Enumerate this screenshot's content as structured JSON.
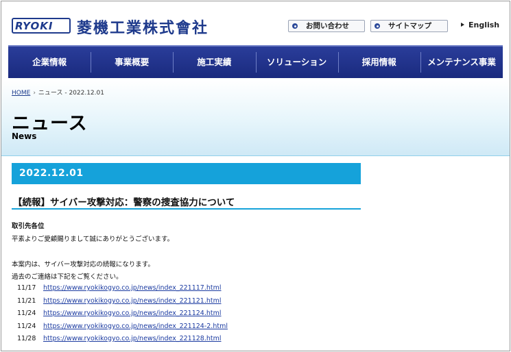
{
  "header": {
    "logo_text": "RYOKI",
    "company_name": "菱機工業株式會社",
    "util_links": [
      "お問い合わせ",
      "サイトマップ"
    ],
    "lang_link": "English"
  },
  "nav": {
    "items": [
      "企業情報",
      "事業概要",
      "施工実績",
      "ソリューション",
      "採用情報",
      "メンテナンス事業"
    ]
  },
  "breadcrumb": {
    "home": "HOME",
    "separator": "›",
    "current": "ニュース - 2022.12.01"
  },
  "page": {
    "title": "ニュース",
    "subtitle": "News"
  },
  "article": {
    "date": "2022.12.01",
    "title": "【続報】サイバー攻撃対応：警察の捜査協力について",
    "addressee": "取引先各位",
    "greeting": "平素よりご愛顧賜りまして誠にありがとうございます。",
    "intro": "本案内は、サイバー攻撃対応の続報になります。",
    "past_note": "過去のご連絡は下記をご覧ください。",
    "links": [
      {
        "date": "11/17",
        "url": "https://www.ryokikogyo.co.jp/news/index_221117.html"
      },
      {
        "date": "11/21",
        "url": "https://www.ryokikogyo.co.jp/news/index_221121.html"
      },
      {
        "date": "11/24",
        "url": "https://www.ryokikogyo.co.jp/news/index_221124.html"
      },
      {
        "date": "11/24",
        "url": "https://www.ryokikogyo.co.jp/news/index_221124-2.html"
      },
      {
        "date": "11/28",
        "url": "https://www.ryokikogyo.co.jp/news/index_221128.html"
      }
    ]
  },
  "colors": {
    "brand_navy": "#1e3a8c",
    "nav_blue": "#1a2a7e",
    "accent_cyan": "#15a2da",
    "link_blue": "#1a3aa0"
  }
}
